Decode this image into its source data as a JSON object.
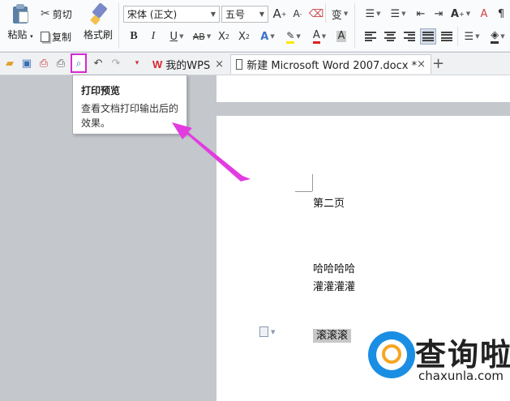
{
  "ribbon": {
    "paste_label": "粘贴",
    "cut_label": "剪切",
    "copy_label": "复制",
    "format_painter_label": "格式刷",
    "font_name": "宋体 (正文)",
    "font_size": "五号",
    "bold": "B",
    "italic": "I",
    "underline": "U",
    "strikethrough": "AB",
    "superscript_base": "X",
    "superscript_mark": "2",
    "subscript_base": "X",
    "subscript_mark": "2",
    "grow_font": "A",
    "shrink_font": "A",
    "font_color_glyph": "A",
    "char_shade_glyph": "A",
    "phonetic_glyph": "变",
    "sort_glyph": "A"
  },
  "tabs": {
    "wps_label": "我的WPS",
    "doc_label": "新建 Microsoft Word 2007.docx *",
    "close_glyph": "×",
    "add_glyph": "+"
  },
  "tooltip": {
    "title": "打印预览",
    "description": "查看文档打印输出后的效果。"
  },
  "document": {
    "line1": "第二页",
    "line2": "哈哈哈哈",
    "line3": "灌灌灌灌",
    "line4": "滚滚滚"
  },
  "watermark": {
    "brand": "查询啦",
    "url": "chaxunla.com"
  },
  "colors": {
    "highlight_border": "#d728d3",
    "arrow": "#e23ce0",
    "font_color_bar": "#e02020",
    "highlight_bar": "#ffe600",
    "watermark_blue": "#1a8ee3",
    "watermark_orange": "#f5a623"
  }
}
